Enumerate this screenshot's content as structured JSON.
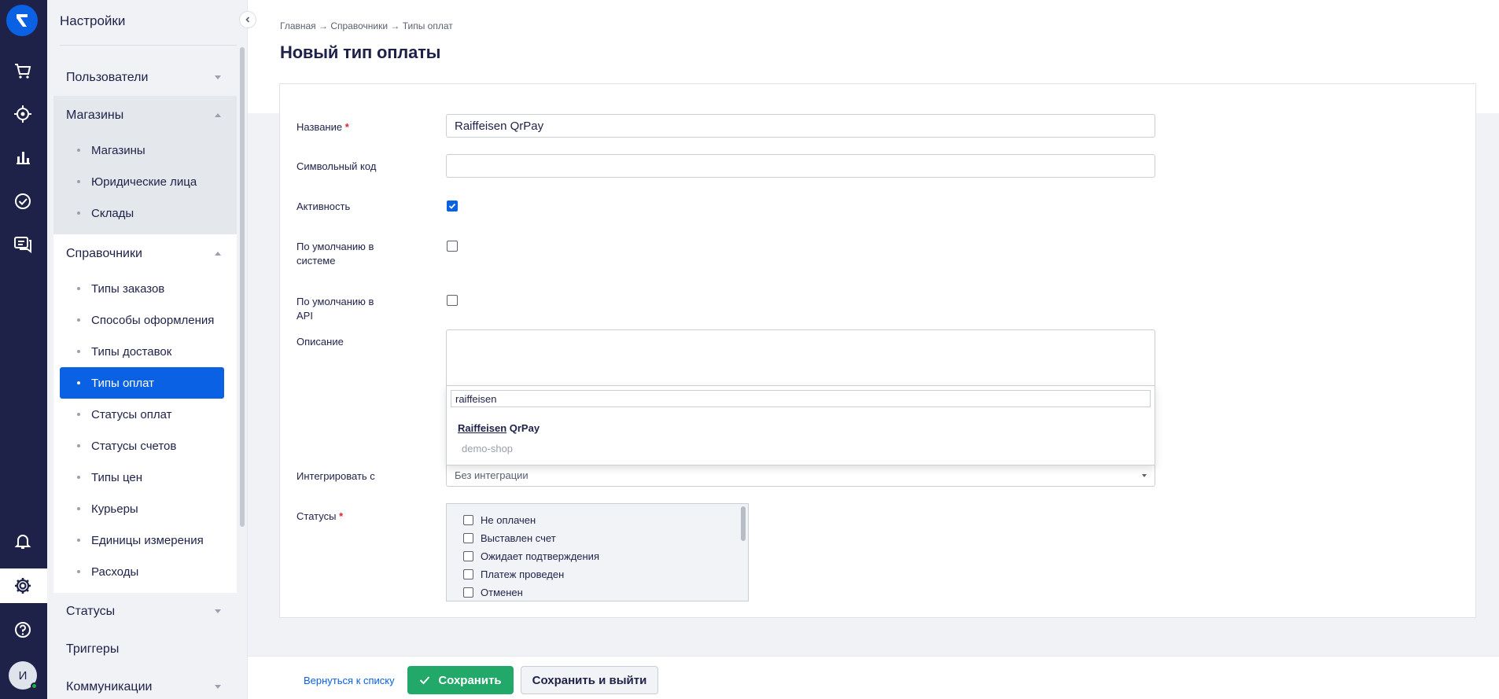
{
  "rail": {
    "icons": [
      "logo-icon",
      "cart-icon",
      "target-icon",
      "analytics-icon",
      "tasks-icon",
      "chat-icon",
      "bell-icon",
      "gear-icon",
      "help-icon"
    ],
    "avatar_initial": "И"
  },
  "sidebar": {
    "title": "Настройки",
    "sections": [
      {
        "label": "Пользователи"
      },
      {
        "label": "Магазины",
        "items": [
          "Магазины",
          "Юридические лица",
          "Склады"
        ]
      },
      {
        "label": "Справочники",
        "items": [
          "Типы заказов",
          "Способы оформления",
          "Типы доставок",
          "Типы оплат",
          "Статусы оплат",
          "Статусы счетов",
          "Типы цен",
          "Курьеры",
          "Единицы измерения",
          "Расходы"
        ]
      },
      {
        "label": "Статусы"
      },
      {
        "label": "Триггеры"
      },
      {
        "label": "Коммуникации"
      }
    ],
    "active_item": "Типы оплат"
  },
  "header": {
    "breadcrumb": "Главная → Справочники → Типы оплат",
    "title": "Новый тип оплаты"
  },
  "form": {
    "name_label": "Название",
    "name_value": "Raiffeisen QrPay",
    "code_label": "Символьный код",
    "code_value": "",
    "active_label": "Активность",
    "active_checked": true,
    "default_system_label": "По умолчанию в системе",
    "default_system_checked": false,
    "default_api_label": "По умолчанию в API",
    "default_api_checked": false,
    "description_label": "Описание",
    "integrate_label": "Интегрировать с",
    "integrate_value": "Без интеграции",
    "dropdown": {
      "search_value": "raiffeisen",
      "option_match": "Raiffeisen",
      "option_rest": " QrPay",
      "group": "demo-shop"
    },
    "statuses_label": "Статусы",
    "statuses": [
      "Не оплачен",
      "Выставлен счет",
      "Ожидает подтверждения",
      "Платеж проведен",
      "Отменен"
    ]
  },
  "footer": {
    "back_label": "Вернуться к списку",
    "save_label": "Сохранить",
    "save_exit_label": "Сохранить и выйти"
  },
  "colors": {
    "rail_bg": "#1e2248",
    "accent": "#0a61e4",
    "save_green": "#22a96a",
    "required": "#e0202f"
  }
}
